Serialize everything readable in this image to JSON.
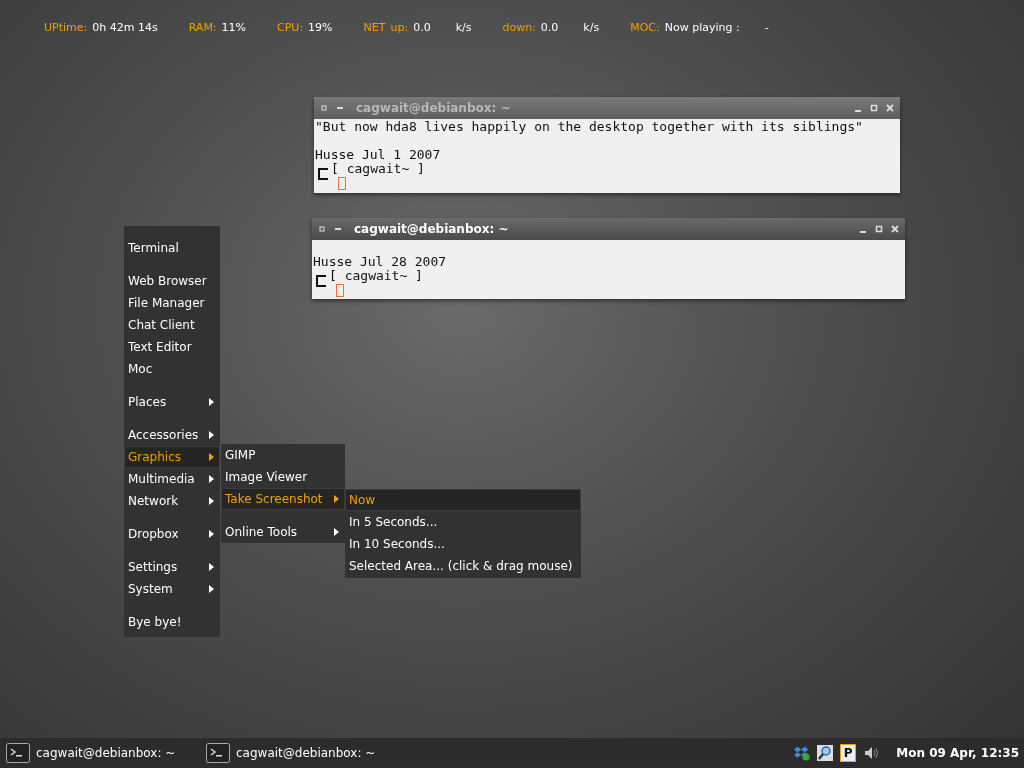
{
  "conky": [
    {
      "kind": "label",
      "text": "UPtime:"
    },
    {
      "kind": "value",
      "text": "0h 42m 14s"
    },
    {
      "kind": "label",
      "text": "RAM:"
    },
    {
      "kind": "value",
      "text": "11%"
    },
    {
      "kind": "label",
      "text": "CPU:"
    },
    {
      "kind": "value",
      "text": "19%"
    },
    {
      "kind": "label",
      "text": "NET"
    },
    {
      "kind": "label",
      "text": "up:"
    },
    {
      "kind": "value",
      "text": "0.0"
    },
    {
      "kind": "unit",
      "text": "k/s"
    },
    {
      "kind": "label",
      "text": "down:"
    },
    {
      "kind": "value",
      "text": "0.0"
    },
    {
      "kind": "unit",
      "text": "k/s"
    },
    {
      "kind": "label",
      "text": "MOC:"
    },
    {
      "kind": "value",
      "text": "Now playing :"
    },
    {
      "kind": "unit",
      "text": "-"
    }
  ],
  "windows": [
    {
      "title": "cagwait@debianbox: ~",
      "active": false,
      "lines": [
        {
          "kind": "text",
          "text": "\"But now hda8 lives happily on the desktop together with its siblings\""
        },
        {
          "kind": "blank"
        },
        {
          "kind": "text",
          "text": "Husse Jul 1 2007"
        }
      ],
      "prompt": "[ cagwait~ ]"
    },
    {
      "title": "cagwait@debianbox: ~",
      "active": true,
      "lines": [
        {
          "kind": "blank"
        },
        {
          "kind": "text",
          "text": "Husse Jul 28 2007"
        }
      ],
      "prompt": "[ cagwait~ ]"
    }
  ],
  "menu": [
    {
      "kind": "separator"
    },
    {
      "kind": "item",
      "label": "Terminal",
      "selected": false
    },
    {
      "kind": "separator"
    },
    {
      "kind": "item",
      "label": "Web Browser",
      "selected": false
    },
    {
      "kind": "item",
      "label": "File Manager",
      "selected": false
    },
    {
      "kind": "item",
      "label": "Chat Client",
      "selected": false
    },
    {
      "kind": "item",
      "label": "Text Editor",
      "selected": false
    },
    {
      "kind": "item",
      "label": "Moc",
      "selected": false
    },
    {
      "kind": "separator"
    },
    {
      "kind": "submenu",
      "label": "Places",
      "selected": false
    },
    {
      "kind": "separator"
    },
    {
      "kind": "submenu",
      "label": "Accessories",
      "selected": false
    },
    {
      "kind": "submenu",
      "label": "Graphics",
      "selected": true
    },
    {
      "kind": "submenu",
      "label": "Multimedia",
      "selected": false
    },
    {
      "kind": "submenu",
      "label": "Network",
      "selected": false
    },
    {
      "kind": "separator"
    },
    {
      "kind": "submenu",
      "label": "Dropbox",
      "selected": false
    },
    {
      "kind": "separator"
    },
    {
      "kind": "submenu",
      "label": "Settings",
      "selected": false
    },
    {
      "kind": "submenu",
      "label": "System",
      "selected": false
    },
    {
      "kind": "separator"
    },
    {
      "kind": "item",
      "label": "Bye bye!",
      "selected": false
    }
  ],
  "graphics_menu": [
    {
      "kind": "item",
      "label": "GIMP",
      "selected": false
    },
    {
      "kind": "item",
      "label": "Image Viewer",
      "selected": false
    },
    {
      "kind": "submenu",
      "label": "Take Screenshot",
      "selected": true
    },
    {
      "kind": "separator"
    },
    {
      "kind": "submenu",
      "label": "Online Tools",
      "selected": false
    }
  ],
  "screenshot_menu": [
    {
      "label": "Now",
      "selected": true
    },
    {
      "label": "In 5 Seconds...",
      "selected": false
    },
    {
      "label": "In 10 Seconds...",
      "selected": false
    },
    {
      "label": "Selected Area... (click & drag mouse)",
      "selected": false
    }
  ],
  "taskbar": {
    "tasks": [
      {
        "label": "cagwait@debianbox: ~"
      },
      {
        "label": "cagwait@debianbox: ~"
      }
    ],
    "tray": [
      {
        "kind": "dropbox"
      },
      {
        "kind": "magnifier"
      },
      {
        "kind": "letter",
        "text": "P"
      },
      {
        "kind": "speaker"
      }
    ],
    "clock": "Mon 09 Apr, 12:35"
  }
}
